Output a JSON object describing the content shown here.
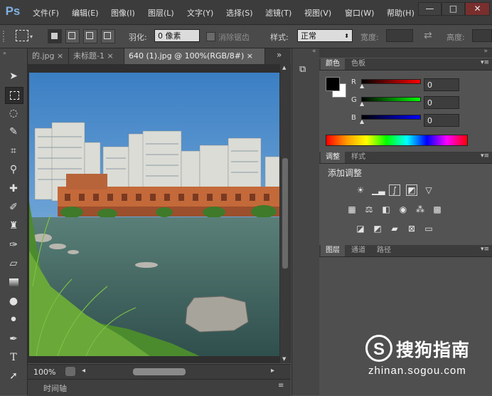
{
  "app": {
    "logo": "Ps"
  },
  "menu": [
    "文件(F)",
    "编辑(E)",
    "图像(I)",
    "图层(L)",
    "文字(Y)",
    "选择(S)",
    "滤镜(T)",
    "视图(V)",
    "窗口(W)",
    "帮助(H)"
  ],
  "window_controls": {
    "minimize": "—",
    "maximize": "□",
    "close": "✕"
  },
  "options": {
    "feather_label": "羽化:",
    "feather_value": "0 像素",
    "antialias_label": "消除锯齿",
    "style_label": "样式:",
    "style_value": "正常",
    "width_label": "宽度:",
    "height_label": "高度:",
    "swap_icon": "⇄"
  },
  "tabs": [
    {
      "label": "的.jpg",
      "close": "×"
    },
    {
      "label": "未标题-1",
      "close": "×"
    },
    {
      "label": "640 (1).jpg @ 100%(RGB/8#)",
      "close": "×"
    }
  ],
  "tabs_overflow": "»",
  "status": {
    "zoom": "100%",
    "left_arrow": "◂",
    "right_arrow": "▸"
  },
  "timeline": {
    "label": "时间轴"
  },
  "color_panel": {
    "tabs": [
      "颜色",
      "色板"
    ],
    "channels": [
      {
        "label": "R",
        "value": "0"
      },
      {
        "label": "G",
        "value": "0"
      },
      {
        "label": "B",
        "value": "0"
      }
    ]
  },
  "adjust_panel": {
    "tabs": [
      "调整",
      "样式"
    ],
    "title": "添加调整"
  },
  "layers_panel": {
    "tabs": [
      "图层",
      "通道",
      "路径"
    ]
  },
  "watermark": {
    "logo": "S",
    "text": "搜狗指南",
    "url": "zhinan.sogou.com"
  },
  "colors": {
    "accent_ps": "#7fb0e0",
    "sky": "#3f82c2",
    "water": "#466a63",
    "grass": "#4c8a2e"
  }
}
